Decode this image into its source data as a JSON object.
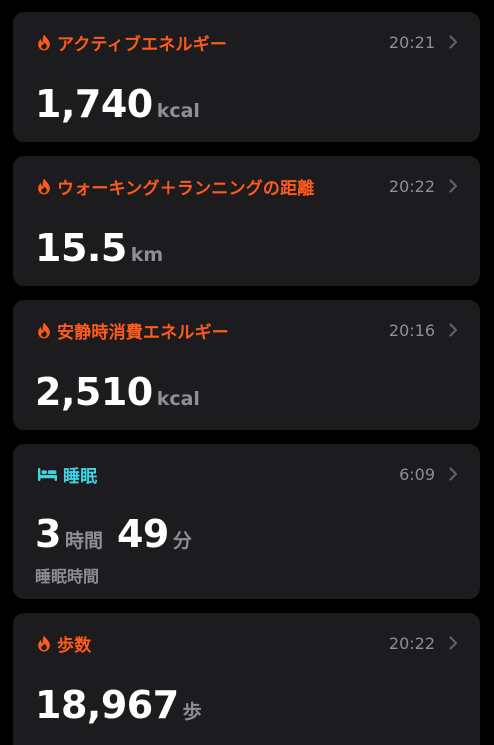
{
  "colors": {
    "background": "#000000",
    "card": "#1c1c1e",
    "activity_accent": "#ff5a1e",
    "sleep_accent": "#3ad6e6",
    "secondary_text": "#8e8e93",
    "primary_text": "#ffffff"
  },
  "cards": [
    {
      "icon": "flame-icon",
      "title": "アクティブエネルギー",
      "time": "20:21",
      "value": "1,740",
      "unit": "kcal"
    },
    {
      "icon": "flame-icon",
      "title": "ウォーキング＋ランニングの距離",
      "time": "20:22",
      "value": "15.5",
      "unit": "km"
    },
    {
      "icon": "flame-icon",
      "title": "安静時消費エネルギー",
      "time": "20:16",
      "value": "2,510",
      "unit": "kcal"
    },
    {
      "icon": "bed-icon",
      "title": "睡眠",
      "time": "6:09",
      "hours": "3",
      "hours_unit": "時間",
      "minutes": "49",
      "minutes_unit": "分",
      "sublabel": "睡眠時間"
    },
    {
      "icon": "flame-icon",
      "title": "歩数",
      "time": "20:22",
      "value": "18,967",
      "unit": "歩"
    }
  ]
}
